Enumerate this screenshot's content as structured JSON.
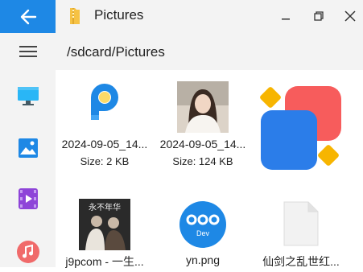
{
  "window": {
    "title": "Pictures",
    "path": "/sdcard/Pictures"
  },
  "sidebar": {
    "items": [
      {
        "icon": "monitor-icon"
      },
      {
        "icon": "image-icon"
      },
      {
        "icon": "video-icon"
      },
      {
        "icon": "music-icon"
      }
    ]
  },
  "files": [
    {
      "name": "2024-09-05_14...",
      "size": "Size: 2 KB",
      "thumb": "app-logo-p"
    },
    {
      "name": "2024-09-05_14...",
      "size": "Size: 124 KB",
      "thumb": "portrait-photo"
    },
    {
      "name": "",
      "size": "",
      "thumb": "colorful-app-icon"
    },
    {
      "name": "j9pcom - 一生...",
      "size": "",
      "thumb": "album-cover"
    },
    {
      "name": "yn.png",
      "size": "",
      "thumb": "dev-logo"
    },
    {
      "name": "仙剑之乱世红...",
      "size": "",
      "thumb": "generic-file"
    }
  ],
  "thumb_texts": {
    "album_title": "永不年华",
    "dev_label": "Dev"
  },
  "colors": {
    "accent": "#1e88e5",
    "chrome": "#f3f3f3"
  }
}
